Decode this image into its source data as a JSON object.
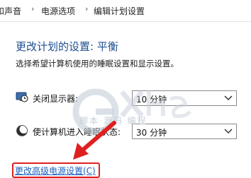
{
  "breadcrumb": {
    "items": [
      "和声音",
      "电源选项",
      "编辑计划设置"
    ],
    "separator": "›"
  },
  "page": {
    "title": "更改计划的设置: 平衡",
    "subtitle": "选择希望计算机使用的睡眠设置和显示设置。"
  },
  "settings": [
    {
      "label": "关闭显示器:",
      "value": "10 分钟",
      "icon": "monitor-clock-icon"
    },
    {
      "label": "使计算机进入睡眠状态:",
      "value": "30 分钟",
      "icon": "moon-sleep-icon"
    }
  ],
  "advanced_link": {
    "label": "更改高级电源设置(C)"
  },
  "watermark": {
    "text": "脚本 源码 编程"
  },
  "colors": {
    "title": "#1d4f91",
    "link": "#1d5fbf",
    "highlight": "#e02020"
  }
}
